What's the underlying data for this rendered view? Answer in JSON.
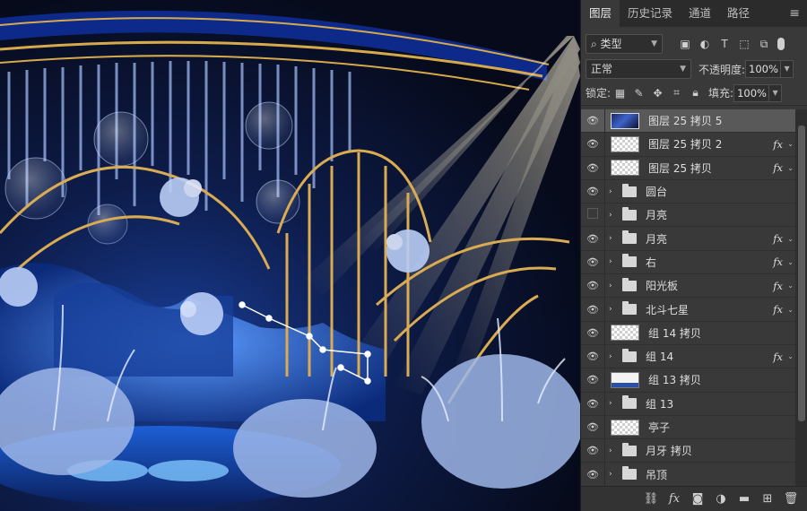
{
  "tabs": [
    "图层",
    "历史记录",
    "通道",
    "路径"
  ],
  "panel_menu_icon": "hamburger-icon",
  "filter": {
    "kind_label": "类型",
    "icons": [
      "image-filter-icon",
      "adjustment-filter-icon",
      "type-filter-icon",
      "shape-filter-icon",
      "smart-object-filter-icon"
    ]
  },
  "blend": {
    "mode": "正常",
    "opacity_label": "不透明度:",
    "opacity_value": "100%"
  },
  "lock": {
    "label": "锁定:",
    "fill_label": "填充:",
    "fill_value": "100%"
  },
  "layers": [
    {
      "name": "图层 25 拷贝 5",
      "type": "image",
      "visible": true,
      "selected": true,
      "fx": false
    },
    {
      "name": "图层 25 拷贝 2",
      "type": "pixel",
      "visible": true,
      "selected": false,
      "fx": true
    },
    {
      "name": "图层 25 拷贝",
      "type": "pixel",
      "visible": true,
      "selected": false,
      "fx": true
    },
    {
      "name": "圆台",
      "type": "group",
      "visible": true,
      "selected": false,
      "fx": false
    },
    {
      "name": "月亮",
      "type": "group",
      "visible": false,
      "selected": false,
      "fx": false
    },
    {
      "name": "月亮",
      "type": "group",
      "visible": true,
      "selected": false,
      "fx": true
    },
    {
      "name": "右",
      "type": "group",
      "visible": true,
      "selected": false,
      "fx": true
    },
    {
      "name": "阳光板",
      "type": "group",
      "visible": true,
      "selected": false,
      "fx": true
    },
    {
      "name": "北斗七星",
      "type": "group",
      "visible": true,
      "selected": false,
      "fx": true
    },
    {
      "name": "组 14 拷贝",
      "type": "pixel",
      "visible": true,
      "selected": false,
      "fx": false
    },
    {
      "name": "组 14",
      "type": "group",
      "visible": true,
      "selected": false,
      "fx": true
    },
    {
      "name": "组 13 拷贝",
      "type": "smart",
      "visible": true,
      "selected": false,
      "fx": false
    },
    {
      "name": "组 13",
      "type": "group",
      "visible": true,
      "selected": false,
      "fx": false
    },
    {
      "name": "亭子",
      "type": "pixel",
      "visible": true,
      "selected": false,
      "fx": false
    },
    {
      "name": "月牙 拷贝",
      "type": "group",
      "visible": true,
      "selected": false,
      "fx": false
    },
    {
      "name": "吊顶",
      "type": "group",
      "visible": true,
      "selected": false,
      "fx": false
    }
  ],
  "fx_label": "fx",
  "bottom_icons": [
    "link-layers-icon",
    "fx-icon",
    "mask-icon",
    "adjustment-icon",
    "new-group-icon",
    "new-layer-icon",
    "delete-icon"
  ],
  "bottom_fx_label": "fx"
}
